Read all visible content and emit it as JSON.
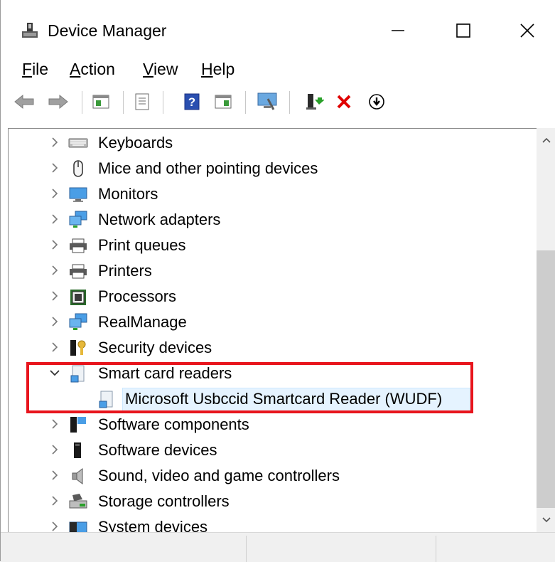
{
  "window": {
    "title": "Device Manager",
    "icon": "device-manager-icon",
    "controls": [
      "minimize-icon",
      "maximize-icon",
      "close-icon"
    ]
  },
  "menu": {
    "file": {
      "mnemonic": "F",
      "rest": "ile"
    },
    "action": {
      "mnemonic": "A",
      "rest": "ction"
    },
    "view": {
      "mnemonic": "V",
      "rest": "iew"
    },
    "help": {
      "mnemonic": "H",
      "rest": "elp"
    }
  },
  "toolbar": {
    "buttons": [
      "back-arrow-icon",
      "forward-arrow-icon",
      "show-hide-console-tree-icon",
      "properties-icon",
      "help-icon",
      "action-pane-icon",
      "scan-hardware-icon",
      "update-driver-icon",
      "uninstall-icon",
      "disable-device-icon"
    ]
  },
  "tree": {
    "items": [
      {
        "label": "Keyboards",
        "icon": "keyboard-icon",
        "expanded": false
      },
      {
        "label": "Mice and other pointing devices",
        "icon": "mouse-icon",
        "expanded": false
      },
      {
        "label": "Monitors",
        "icon": "monitor-icon",
        "expanded": false
      },
      {
        "label": "Network adapters",
        "icon": "network-adapter-icon",
        "expanded": false
      },
      {
        "label": "Print queues",
        "icon": "printer-icon",
        "expanded": false
      },
      {
        "label": "Printers",
        "icon": "printer-icon",
        "expanded": false
      },
      {
        "label": "Processors",
        "icon": "processor-icon",
        "expanded": false
      },
      {
        "label": "RealManage",
        "icon": "network-adapter-icon",
        "expanded": false
      },
      {
        "label": "Security devices",
        "icon": "security-key-icon",
        "expanded": false
      },
      {
        "label": "Smart card readers",
        "icon": "smart-card-reader-icon",
        "expanded": true
      },
      {
        "label": "Microsoft Usbccid Smartcard Reader (WUDF)",
        "icon": "smart-card-reader-icon",
        "child": true,
        "selected": true
      },
      {
        "label": "Software components",
        "icon": "software-component-icon",
        "expanded": false
      },
      {
        "label": "Software devices",
        "icon": "software-device-icon",
        "expanded": false
      },
      {
        "label": "Sound, video and game controllers",
        "icon": "speaker-icon",
        "expanded": false
      },
      {
        "label": "Storage controllers",
        "icon": "storage-controller-icon",
        "expanded": false
      },
      {
        "label": "System devices",
        "icon": "system-devices-icon",
        "expanded": false
      }
    ]
  },
  "colors": {
    "highlight_box": "#e8141c",
    "selection": "#e5f3ff",
    "uninstall_red": "#e00000"
  }
}
